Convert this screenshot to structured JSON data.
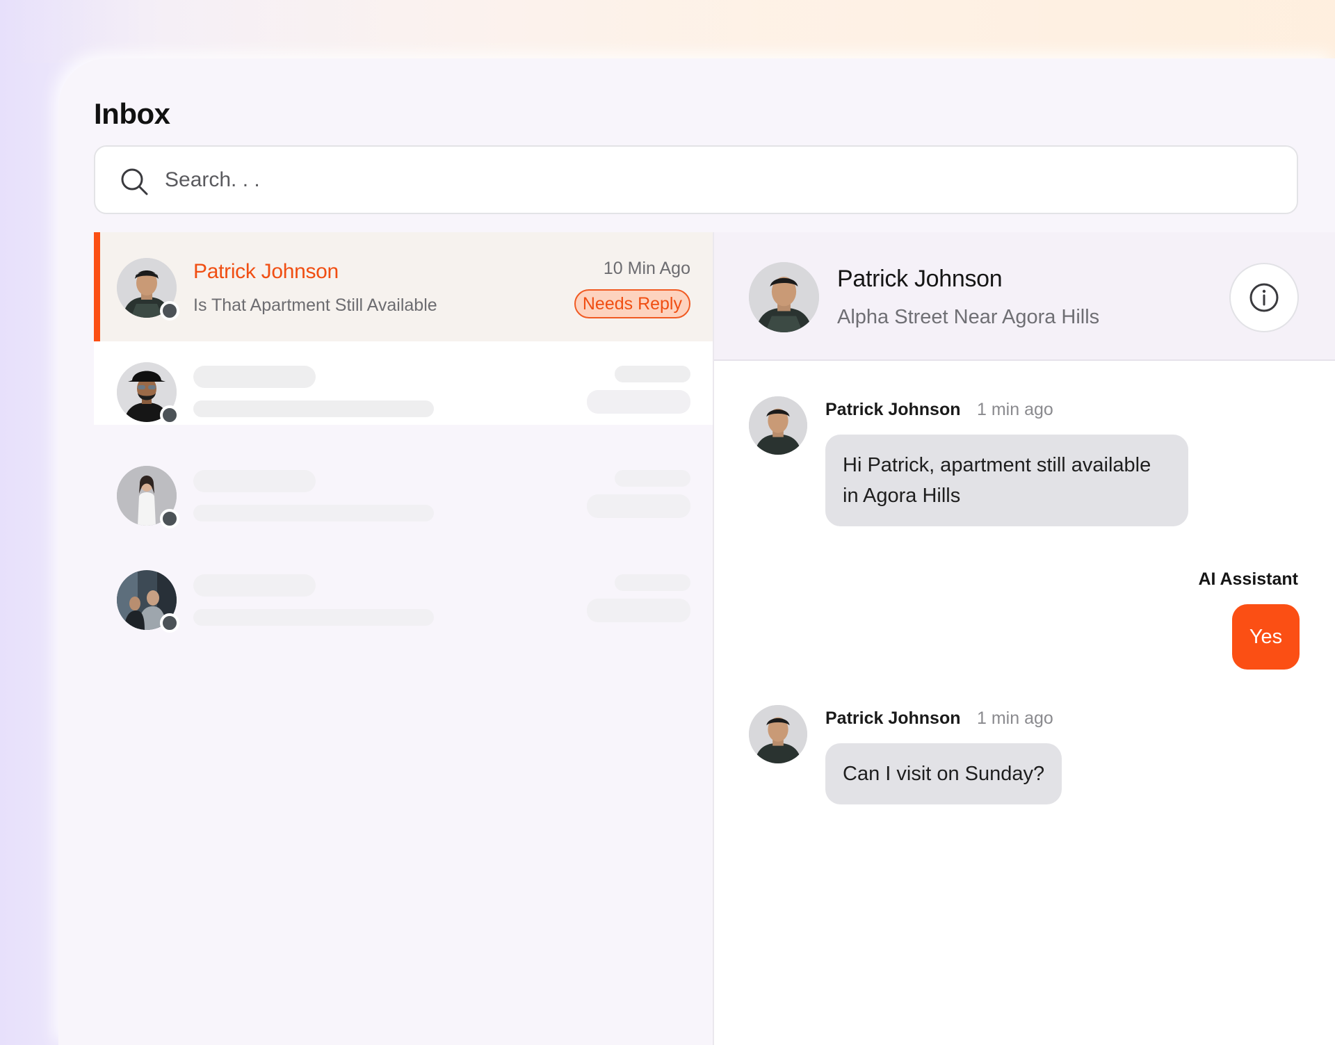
{
  "app": {
    "title": "Inbox"
  },
  "search": {
    "placeholder": "Search. . .",
    "value": ""
  },
  "conversations": [
    {
      "name": "Patrick Johnson",
      "preview": "Is That Apartment Still Available",
      "time": "10 Min Ago",
      "badge": "Needs Reply",
      "active": true
    },
    {
      "name": "",
      "preview": "",
      "time": "",
      "loading": true
    },
    {
      "name": "",
      "preview": "",
      "time": "",
      "loading": true
    },
    {
      "name": "",
      "preview": "",
      "time": "",
      "loading": true
    }
  ],
  "chat": {
    "contact_name": "Patrick Johnson",
    "contact_subtitle": "Alpha Street Near Agora Hills",
    "messages": [
      {
        "sender": "Patrick Johnson",
        "time": "1 min ago",
        "text": "Hi Patrick, apartment still available in Agora Hills"
      },
      {
        "sender": "AI Assistant",
        "text": "Yes"
      },
      {
        "sender": "Patrick Johnson",
        "time": "1 min ago",
        "text": "Can I visit on Sunday?"
      }
    ]
  },
  "icons": {
    "search": "search-icon",
    "info": "info-icon",
    "status": "status-dot"
  },
  "colors": {
    "accent": "#fb4f14",
    "badge_bg": "#fdd3bf",
    "bubble": "#e2e2e6",
    "status_dot": "#4c5257"
  }
}
